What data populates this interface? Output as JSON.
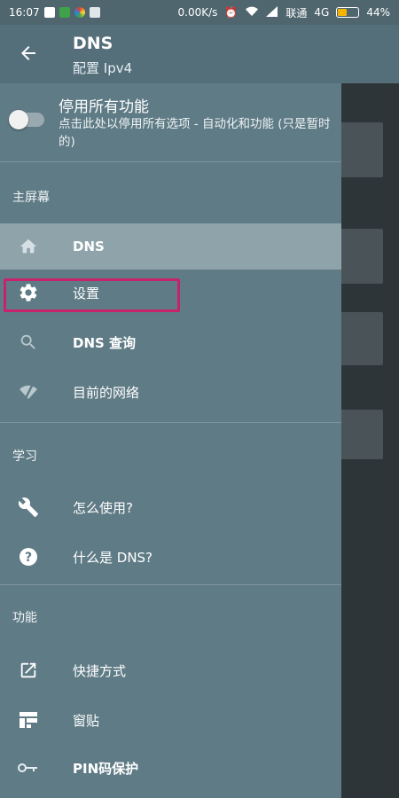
{
  "status_bar": {
    "time": "16:07",
    "network_speed": "0.00K/s",
    "carrier": "联通",
    "network_type": "4G",
    "battery_percent": "44%",
    "battery_level": 0.44
  },
  "app_bar": {
    "title": "DNS",
    "subtitle": "配置 Ipv4"
  },
  "drawer": {
    "toggle": {
      "title": "停用所有功能",
      "description": "点击此处以停用所有选项 - 自动化和功能 (只是暂时的)",
      "enabled": false
    },
    "sections": [
      {
        "label": "主屏幕",
        "items": [
          {
            "label": "DNS",
            "icon": "home-icon"
          },
          {
            "label": "设置",
            "icon": "gear-icon"
          },
          {
            "label": "DNS 查询",
            "icon": "search-icon"
          },
          {
            "label": "目前的网络",
            "icon": "wifi-off-icon"
          }
        ]
      },
      {
        "label": "学习",
        "items": [
          {
            "label": "怎么使用?",
            "icon": "wrench-icon"
          },
          {
            "label": "什么是 DNS?",
            "icon": "help-icon"
          }
        ]
      },
      {
        "label": "功能",
        "items": [
          {
            "label": "快捷方式",
            "icon": "open-in-new-icon"
          },
          {
            "label": "窗贴",
            "icon": "widget-icon"
          },
          {
            "label": "PIN码保护",
            "icon": "key-icon"
          }
        ]
      }
    ]
  },
  "colors": {
    "app_bar": "#546e7a",
    "drawer": "#5f7b85",
    "active_item": "#8fa3aa",
    "highlight": "#c8236a"
  }
}
